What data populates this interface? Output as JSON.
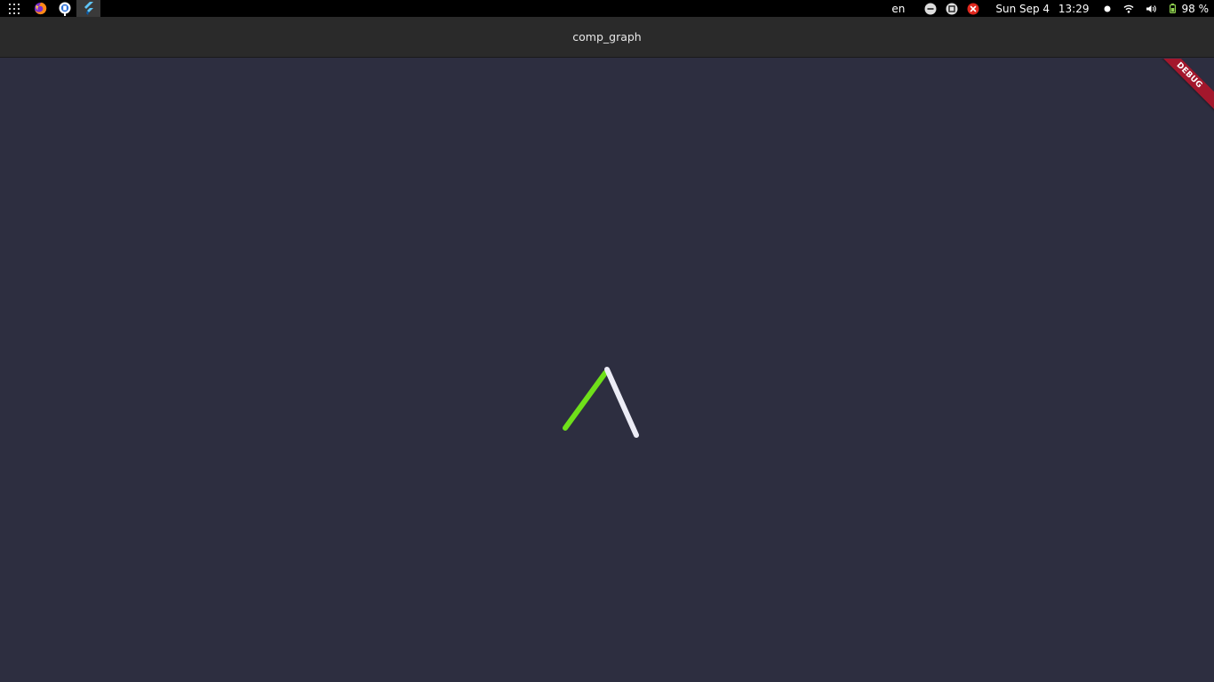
{
  "system_bar": {
    "language": "en",
    "date": "Sun Sep 4",
    "time": "13:29",
    "battery_percent": "98 %",
    "dock_apps": [
      "firefox-icon",
      "app-icon",
      "flutter-icon"
    ],
    "active_app": "flutter-icon"
  },
  "window": {
    "title": "comp_graph"
  },
  "debug_banner": {
    "label": "DEBUG"
  },
  "colors": {
    "background": "#2d2e40",
    "edge_green": "#6fe01a",
    "edge_white": "#ececf6",
    "banner": "#a3172c"
  },
  "graph": {
    "edges": [
      {
        "name": "green-edge",
        "color": "#6fe01a"
      },
      {
        "name": "white-edge",
        "color": "#ececf6"
      }
    ]
  }
}
